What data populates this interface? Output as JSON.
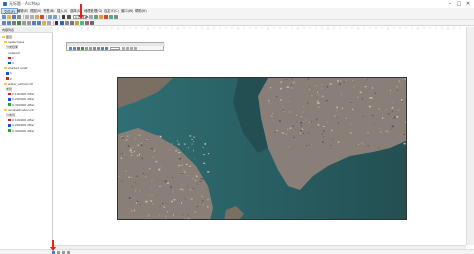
{
  "window": {
    "title": "无标题 - ArcMap",
    "minimize": "–",
    "maximize": "□",
    "close": "✕"
  },
  "menu": [
    {
      "id": "file",
      "label": "文件(F)"
    },
    {
      "id": "edit",
      "label": "编辑(E)"
    },
    {
      "id": "view",
      "label": "视图(V)"
    },
    {
      "id": "bookmark",
      "label": "书签(B)"
    },
    {
      "id": "insert",
      "label": "插入(I)"
    },
    {
      "id": "selection",
      "label": "选择(S)"
    },
    {
      "id": "geoprocessing",
      "label": "地理处理(G)"
    },
    {
      "id": "customize",
      "label": "自定义(C)"
    },
    {
      "id": "windows",
      "label": "窗口(W)"
    },
    {
      "id": "help",
      "label": "帮助(H)"
    }
  ],
  "toolbar": {
    "scale": "1:76,198"
  },
  "toc": {
    "header": "内容列表",
    "layers": [
      {
        "label": "图层",
        "color": "#f2c94c"
      },
      {
        "label": "rasterclass",
        "color": "#f2c94c"
      },
      {
        "label": "分类结果",
        "color": ""
      },
      {
        "label": "network",
        "color": ""
      },
      {
        "label": "1",
        "color": "#d62728"
      },
      {
        "label": "2",
        "color": "#1f4ed8"
      },
      {
        "label": "shaded relief",
        "color": "#f2c94c"
      },
      {
        "label": "1",
        "color": "#1f4ed8"
      },
      {
        "label": "2",
        "color": "#d62728"
      },
      {
        "label": "water_extract.tif",
        "color": "#f2c94c"
      },
      {
        "label": "类别",
        "color": ""
      },
      {
        "label": "0.100000 After",
        "color": "#d62728"
      },
      {
        "label": "0.200000 After",
        "color": "#1f4ed8"
      },
      {
        "label": "0.300000 After",
        "color": "#2ca02c"
      },
      {
        "label": "reclassifcation.tif",
        "color": "#f2c94c"
      },
      {
        "label": "分类值",
        "color": ""
      },
      {
        "label": "0.100000 After",
        "color": "#d62728"
      },
      {
        "label": "0.200000 After",
        "color": "#1f4ed8"
      },
      {
        "label": "0.300000 After",
        "color": "#2ca02c"
      }
    ]
  },
  "colors": {
    "water": "#2f6f74",
    "water_dark": "#234f52",
    "land": "#7b6e63",
    "urban": "#8a7f78",
    "arrow": "#e0241a"
  }
}
